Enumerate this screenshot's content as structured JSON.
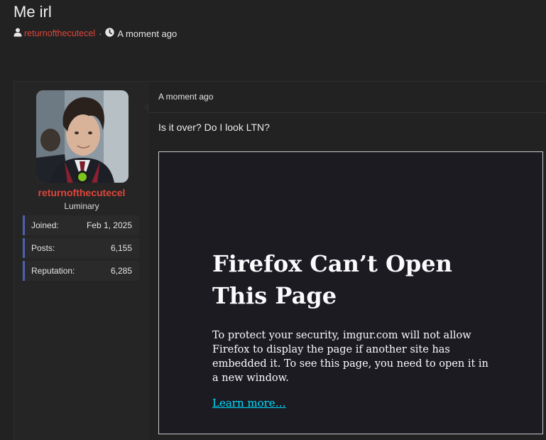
{
  "thread": {
    "title": "Me irl",
    "author": "returnofthecutecel",
    "separator": "·",
    "time": "A moment ago"
  },
  "post": {
    "time": "A moment ago",
    "text": "Is it over? Do I look LTN?",
    "user": {
      "username": "returnofthecutecel",
      "title": "Luminary",
      "online": true,
      "stats": [
        {
          "label": "Joined:",
          "value": "Feb 1, 2025"
        },
        {
          "label": "Posts:",
          "value": "6,155"
        },
        {
          "label": "Reputation:",
          "value": "6,285"
        }
      ]
    },
    "embed": {
      "title": "Firefox Can’t Open This Page",
      "body": "To protect your security, imgur.com will not allow Firefox to display the page if another site has embedded it. To see this page, you need to open it in a new window.",
      "link": "Learn more…"
    }
  },
  "colors": {
    "accent_red": "#e0453b",
    "online_green": "#7cc51c",
    "stat_border": "#4c62b0",
    "link_cyan": "#00ddff"
  },
  "icons": {
    "author": "user-icon",
    "time": "clock-icon"
  }
}
